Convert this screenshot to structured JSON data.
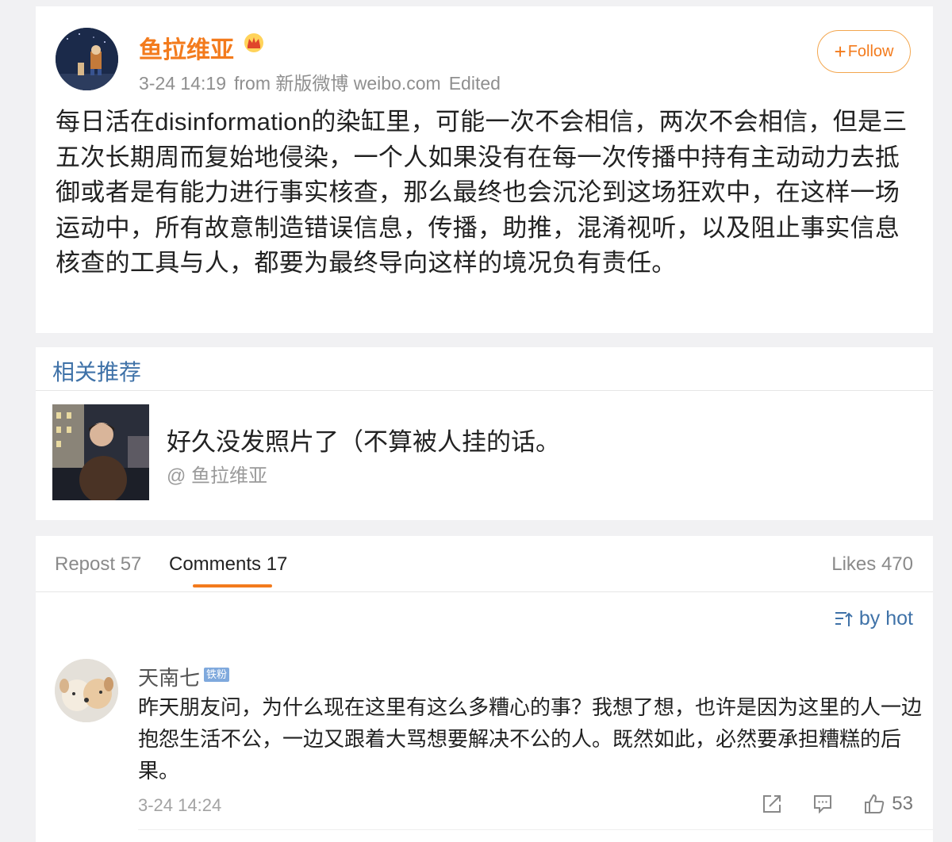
{
  "post": {
    "author": "鱼拉维亚",
    "time": "3-24 14:19",
    "source": "from 新版微博 weibo.com",
    "edited": "Edited",
    "follow_label": "Follow",
    "body": "每日活在disinformation的染缸里，可能一次不会相信，两次不会相信，但是三五次长期周而复始地侵染，一个人如果没有在每一次传播中持有主动动力去抵御或者是有能力进行事实核查，那么最终也会沉沦到这场狂欢中，在这样一场运动中，所有故意制造错误信息，传播，助推，混淆视听，以及阻止事实信息核查的工具与人，都要为最终导向这样的境况负有责任。"
  },
  "related": {
    "title": "相关推荐",
    "item_text": "好久没发照片了（不算被人挂的话。",
    "item_author": "@ 鱼拉维亚"
  },
  "tabs": {
    "repost": "Repost 57",
    "comments": "Comments 17",
    "likes": "Likes 470"
  },
  "sort_label": "by hot",
  "comment": {
    "author": "天南七",
    "badge": "铁粉",
    "body": "昨天朋友问，为什么现在这里有这么多糟心的事？我想了想，也许是因为这里的人一边抱怨生活不公，一边又跟着大骂想要解决不公的人。既然如此，必然要承担糟糕的后果。",
    "time": "3-24 14:24",
    "likes": "53"
  },
  "colors": {
    "accent": "#f37b1d",
    "link_blue": "#3f72a8",
    "badge_blue": "#7fa9dd"
  }
}
